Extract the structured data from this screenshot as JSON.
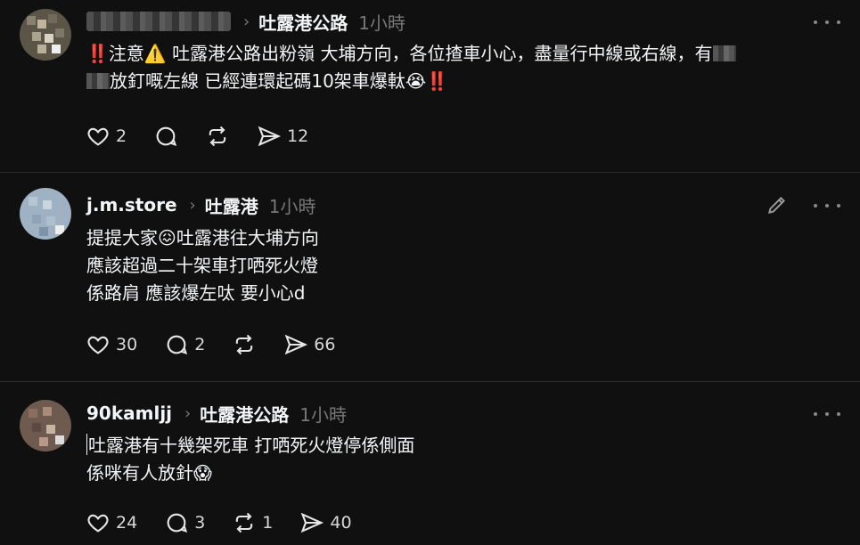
{
  "posts": [
    {
      "username": "",
      "topic": "吐露港公路",
      "time": "1小時",
      "line1_prefix": "‼️注意⚠️ 吐露港公路出粉嶺 大埔方向，各位揸車小心，盡量行中線或右線，有",
      "line2_suffix": "放釘嘅左線 已經連環起碼10架車爆軚",
      "emoji_end": "😭‼️",
      "likes": "2",
      "reposts": "",
      "shares": "12"
    },
    {
      "username": "j.m.store",
      "topic": "吐露港",
      "time": "1小時",
      "line1": "提提大家😖吐露港往大埔方向",
      "line2": "應該超過二十架車打哂死火燈",
      "line3": "係路肩 應該爆左呔 要小心d",
      "likes": "30",
      "replies": "2",
      "shares": "66"
    },
    {
      "username": "90kamljj",
      "topic": "吐露港公路",
      "time": "1小時",
      "line1": "吐露港有十幾架死車 打哂死火燈停係側面",
      "line2": "係咪有人放針😱",
      "likes": "24",
      "replies": "3",
      "reposts": "1",
      "shares": "40"
    }
  ],
  "colors": {
    "background": "#101010",
    "text": "#f3f5f7",
    "muted": "#777777",
    "divider": "#2d2d2d"
  }
}
